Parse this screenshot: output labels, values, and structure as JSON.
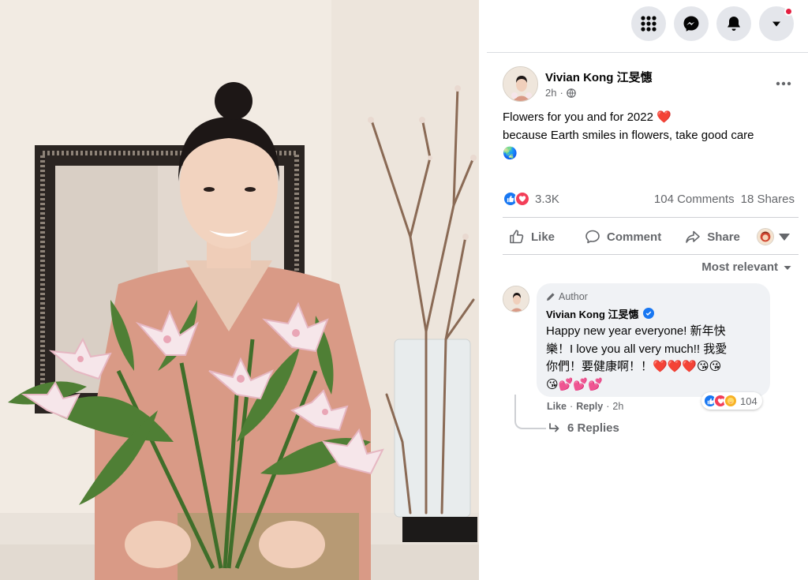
{
  "photo": {
    "description_icon": "photo-of-woman-with-lilies"
  },
  "topbar": {
    "menu_icon": "grid-menu-icon",
    "messenger_icon": "messenger-icon",
    "notifications_icon": "bell-icon",
    "account_icon": "caret-down-icon"
  },
  "post": {
    "author": "Vivian Kong 江旻憓",
    "time": "2h",
    "privacy_icon": "globe-icon",
    "text_lines": [
      "Flowers for you and for 2022 ❤️",
      "because Earth smiles in flowers, take good care",
      "🌏"
    ],
    "reactions_count": "3.3K",
    "comments_count": "104 Comments",
    "shares_count": "18 Shares"
  },
  "actions": {
    "like": "Like",
    "comment": "Comment",
    "share": "Share"
  },
  "sort_label": "Most relevant",
  "comment": {
    "badge": "Author",
    "author": "Vivian Kong 江旻憓",
    "lines": [
      "Happy new year everyone! 新年快",
      "樂！I love you all very much!! 我愛",
      "你們！要健康啊！！❤️❤️❤️😘😘",
      "😘💕💕💕"
    ],
    "reaction_count": "104",
    "like": "Like",
    "separator": "·",
    "reply": "Reply",
    "time": "2h"
  },
  "replies_label": "6 Replies",
  "colors": {
    "fb_blue": "#1877f2",
    "love_red": "#f33e58",
    "secondary_text": "#65676b",
    "bubble_bg": "#f0f2f5"
  }
}
